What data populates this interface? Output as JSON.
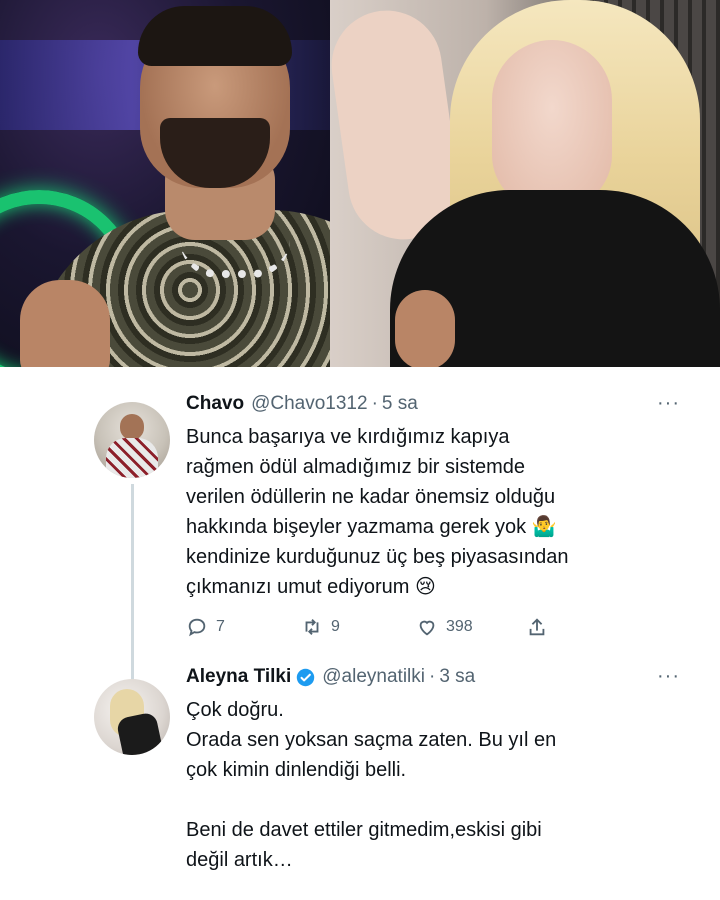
{
  "tweets": [
    {
      "name": "Chavo",
      "handle": "@Chavo1312",
      "separator": "·",
      "time": "5 sa",
      "more": "···",
      "text": "Bunca başarıya ve kırdığımız kapıya\nrağmen ödül almadığımız bir sistemde\nverilen ödüllerin ne kadar önemsiz olduğu\nhakkında bişeyler yazmama gerek yok 🤷‍♂️\nkendinize kurduğunuz üç beş piyasasından\nçıkmanızı umut ediyorum 😢",
      "replies": "7",
      "retweets": "9",
      "likes": "398",
      "colors": {
        "name": "#0f1419",
        "meta": "#536471"
      }
    },
    {
      "name": "Aleyna Tilki",
      "handle": "@aleynatilki",
      "separator": "·",
      "time": "3 sa",
      "more": "···",
      "verified": true,
      "text": "Çok doğru.\nOrada sen yoksan saçma zaten. Bu yıl en\nçok kimin dinlendiği belli.\n\nBeni de davet ettiler gitmedim,eskisi gibi\ndeğil artık…",
      "colors": {
        "verified": "#1d9bf0"
      }
    }
  ],
  "icons": [
    "reply-icon",
    "retweet-icon",
    "like-icon",
    "share-icon",
    "verified-badge-icon",
    "more-icon"
  ]
}
